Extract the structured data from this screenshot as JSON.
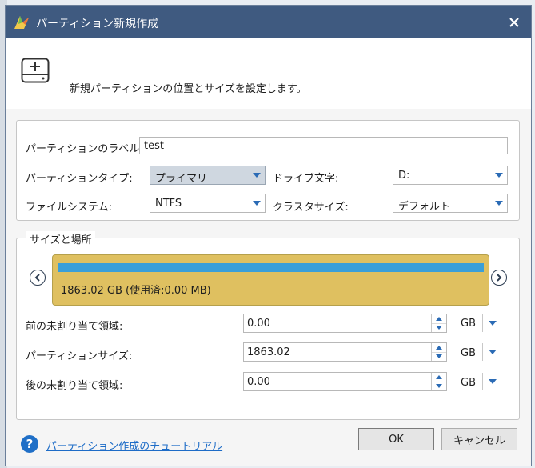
{
  "window": {
    "title": "パーティション新規作成"
  },
  "header": {
    "text": "新規パーティションの位置とサイズを設定します。"
  },
  "properties": {
    "label_caption": "パーティションのラベル:",
    "label_value": "test",
    "type_caption": "パーティションタイプ:",
    "type_value": "プライマリ",
    "drive_caption": "ドライブ文字:",
    "drive_value": "D:",
    "fs_caption": "ファイルシステム:",
    "fs_value": "NTFS",
    "cluster_caption": "クラスタサイズ:",
    "cluster_value": "デフォルト"
  },
  "size_location": {
    "caption": "サイズと場所",
    "partition_text": "1863.02 GB (使用済:0.00 MB)",
    "rows": [
      {
        "label": "前の未割り当て領域:",
        "value": "0.00",
        "unit": "GB"
      },
      {
        "label": "パーティションサイズ:",
        "value": "1863.02",
        "unit": "GB"
      },
      {
        "label": "後の未割り当て領域:",
        "value": "0.00",
        "unit": "GB"
      }
    ]
  },
  "footer": {
    "help_link": "パーティション作成のチュートリアル",
    "ok_label": "OK",
    "cancel_label": "キャンセル"
  },
  "colors": {
    "titlebar": "#3f5a80",
    "partition_fill": "#dfc060",
    "usage_bar": "#3a9fd8",
    "link": "#1d6cc7"
  }
}
